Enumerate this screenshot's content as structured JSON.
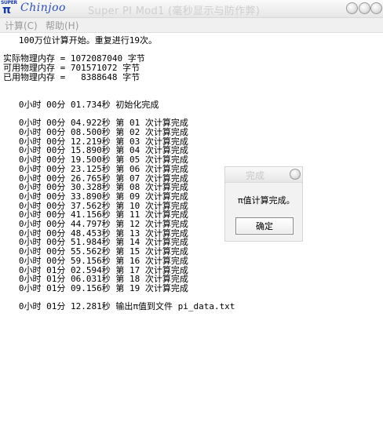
{
  "window": {
    "brand_super": "SUPER",
    "brand_pi": "π",
    "brand_name": "Chinjoo",
    "title": "Super PI Mod1 (毫秒显示与防作弊)"
  },
  "menu": {
    "items": [
      {
        "label": "计算(C)"
      },
      {
        "label": "帮助(H)"
      }
    ]
  },
  "log": {
    "lines": [
      "   100万位计算开始。重复进行19次。",
      "",
      "实际物理内存 = 1072087040 字节",
      "可用物理内存 = 701571072 字节",
      "已用物理内存 =   8388648 字节",
      "",
      "",
      "   0小时 00分 01.734秒 初始化完成",
      "",
      "   0小时 00分 04.922秒 第 01 次计算完成",
      "   0小时 00分 08.500秒 第 02 次计算完成",
      "   0小时 00分 12.219秒 第 03 次计算完成",
      "   0小时 00分 15.890秒 第 04 次计算完成",
      "   0小时 00分 19.500秒 第 05 次计算完成",
      "   0小时 00分 23.125秒 第 06 次计算完成",
      "   0小时 00分 26.765秒 第 07 次计算完成",
      "   0小时 00分 30.328秒 第 08 次计算完成",
      "   0小时 00分 33.890秒 第 09 次计算完成",
      "   0小时 00分 37.562秒 第 10 次计算完成",
      "   0小时 00分 41.156秒 第 11 次计算完成",
      "   0小时 00分 44.797秒 第 12 次计算完成",
      "   0小时 00分 48.453秒 第 13 次计算完成",
      "   0小时 00分 51.984秒 第 14 次计算完成",
      "   0小时 00分 55.562秒 第 15 次计算完成",
      "   0小时 00分 59.156秒 第 16 次计算完成",
      "   0小时 01分 02.594秒 第 17 次计算完成",
      "   0小时 01分 06.031秒 第 18 次计算完成",
      "   0小时 01分 09.156秒 第 19 次计算完成",
      "",
      "   0小时 01分 12.281秒 输出π值到文件 pi_data.txt"
    ]
  },
  "dialog": {
    "title": "完成",
    "message": "π值计算完成。",
    "ok_label": "确定"
  },
  "icons": {
    "min": "minimize-icon",
    "max": "maximize-icon",
    "close": "close-icon"
  }
}
